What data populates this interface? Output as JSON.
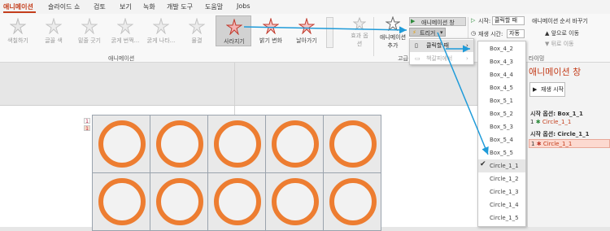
{
  "tabs": [
    "애니메이션",
    "슬라이드 쇼",
    "검토",
    "보기",
    "녹화",
    "개발 도구",
    "도움말",
    "Jobs"
  ],
  "ribbon": {
    "animations": [
      "색칠하기",
      "글꼴 색",
      "밑줄 긋기",
      "굵게 번쩍...",
      "굵게 나타...",
      "물결",
      "사라지기",
      "밝기 변화",
      "날아가기"
    ],
    "effect_options": "효과 옵션",
    "add_animation": "애니메이션 추가",
    "group_animation": "애니메이션",
    "group_advanced": "고급",
    "animation_pane": "애니메이션 창",
    "trigger": "트리거",
    "start_label": "시작:",
    "start_value": "클릭할 때",
    "duration_label": "재생 시간:",
    "duration_value": "자동",
    "reorder": "애니메이션 순서 바꾸기",
    "move_earlier": "앞으로 이동",
    "move_later": "뒤로 이동",
    "group_timing": "타이밍"
  },
  "trigger_menu": {
    "on_click": "클릭할 때",
    "on_bookmark": "책갈피에서"
  },
  "object_list": [
    "Box_4_2",
    "Box_4_3",
    "Box_4_4",
    "Box_4_5",
    "Box_5_1",
    "Box_5_2",
    "Box_5_3",
    "Box_5_4",
    "Box_5_5",
    "Circle_1_1",
    "Circle_1_2",
    "Circle_1_3",
    "Circle_1_4",
    "Circle_1_5"
  ],
  "object_list_checked": "Circle_1_1",
  "pane": {
    "title": "애니메이션 창",
    "play": "재생 시작",
    "trigger1_head": "시작 옵션: Box_1_1",
    "trigger1_item": "Circle_1_1",
    "trigger1_num": "1",
    "trigger2_head": "시작 옵션: Circle_1_1",
    "trigger2_item": "Circle_1_1",
    "trigger2_num": "1"
  },
  "slide_markers": [
    "1",
    "1"
  ],
  "colors": {
    "accent": "#c43e1c",
    "ring": "#ed7d31",
    "arrow": "#1f9bd9",
    "selected_row": "#fcd9d0"
  }
}
